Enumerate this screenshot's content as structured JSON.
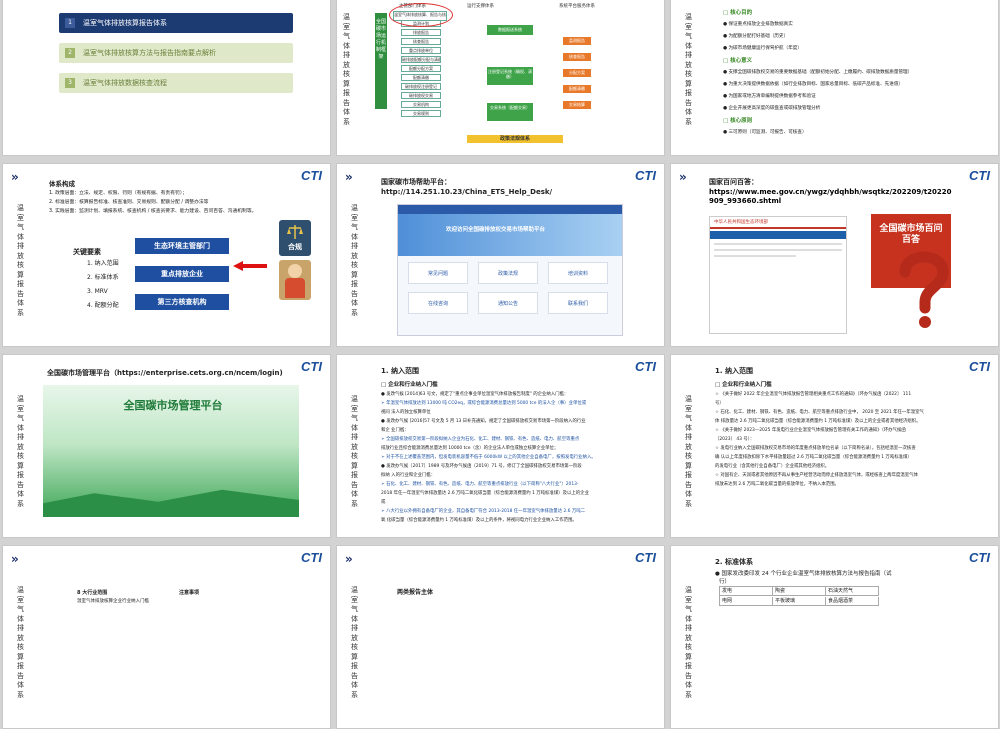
{
  "vertical_caption": "温室气体排放核算报告体系",
  "logo_text": "CTI",
  "chevron": "»",
  "slide1": {
    "items": [
      {
        "num": "1",
        "label": "温室气体排放核算报告体系"
      },
      {
        "num": "2",
        "label": "温室气体排放核算方法与报告指南要点解析"
      },
      {
        "num": "3",
        "label": "温室气体排放数据核查流程"
      }
    ]
  },
  "slide2": {
    "vertical_label": "全国碳市场运行机制框架",
    "col_heads": [
      "主管部门体系",
      "运行支撑体系",
      "系统平台服务体系"
    ],
    "left_boxes": [
      "温室气体排放核算、报告与核查",
      "监测计划",
      "排放报告",
      "核查报告",
      "重点排放单位",
      "碳排放配额分配与清缴",
      "配额分配方案",
      "配额清缴",
      "碳排放权注册登记",
      "碳排放权交易",
      "交易机构",
      "交易规则"
    ],
    "green_boxes": [
      "数据报送系统",
      "注册登记系统（确权、清缴）",
      "交易系统（配额交易）"
    ],
    "right_labels": [
      "监测报告",
      "核查报告",
      "分配方案",
      "配额清缴",
      "交易结算"
    ],
    "bottom_label": "政策法规体系"
  },
  "slide3": {
    "lines": [
      {
        "marker": "□",
        "text": "核心目的",
        "style": "green"
      },
      {
        "marker": "●",
        "text": "保证重点排放企业排放数据真实",
        "style": ""
      },
      {
        "marker": "●",
        "text": "为配额分配打好基础（历史）",
        "style": ""
      },
      {
        "marker": "●",
        "text": "为碳市场健康运行保驾护航（年度）",
        "style": ""
      },
      {
        "marker": "□",
        "text": "核心意义",
        "style": "green"
      },
      {
        "marker": "●",
        "text": "支撑全国碳排放权交易的重要数据基础（配额初始分配、上缴履约、碳排放数据质量管理）",
        "style": ""
      },
      {
        "marker": "●",
        "text": "为重大决策提供数据依据（如行业排放目标、国家总量目标、低碳产品标准、先进值）",
        "style": ""
      },
      {
        "marker": "●",
        "text": "为国家或地方清单编制提供数据参考和验证",
        "style": ""
      },
      {
        "marker": "●",
        "text": "企业开展更高深度的碳盘查或碳排放管理分析",
        "style": ""
      },
      {
        "marker": "□",
        "text": "核心原则",
        "style": "green"
      },
      {
        "marker": "●",
        "text": "三可原则（可监测、可报告、可核查）",
        "style": ""
      }
    ]
  },
  "slide4": {
    "title": "体系构成",
    "lines": [
      "1. 政策层面：立法、规定、权限、罚则（有规有据、有责有罚）；",
      "2. 标准层面：核算报告标准、核查准则、交易规则、配额分配 / 调整办法等",
      "3. 实践层面：监测计划、填报系统、核查机构 / 核查员要求、能力建设、百问百答、沟通机制等。"
    ],
    "key_title": "关键要素",
    "key_items": [
      "1. 纳入范围",
      "2. 标准体系",
      "3. MRV",
      "4. 配额分配"
    ],
    "buttons": [
      "生态环境主管部门",
      "重点排放企业",
      "第三方核查机构"
    ],
    "badge": "合规"
  },
  "slide5": {
    "title": "国家碳市场帮助平台：",
    "url": "http://114.251.10.23/China_ETS_Help_Desk/",
    "banner": "欢迎访问全国碳排放权交易市场帮助平台",
    "tiles": [
      "常见问题",
      "政策法规",
      "培训资料",
      "在线咨询",
      "通知公告",
      "联系我们"
    ]
  },
  "slide6": {
    "title": "国家百问百答：",
    "url": "https://www.mee.gov.cn/ywgz/ydqhbh/wsqtkz/202209/t20220909_993660.shtml",
    "site_header": "中华人民共和国生态环境部",
    "book_title": "全国碳市场百问百答"
  },
  "slide7": {
    "title": "全国碳市场管理平台（https://enterprise.cets.org.cn/ncem/login)",
    "banner": "全国碳市场管理平台"
  },
  "slide8": {
    "heading": "1. 纳入范围",
    "sub": "□ 企业和行业纳入门槛",
    "lines": [
      "● 发改气候 [2014]63 号文，规定了\"重点企事业单位温室气体排放报告制度\" 的企业纳入门槛：",
      "➢ 年温室气体排放达到 13000 吨 CO2eq，或综合能源消费总量达到 5000 tce 的法人企（事）业单位或",
      "视同  法人的独立核算单位",
      "● 发改办气候 [2016]57 号文及 5 月 13 日补充通知，规定了全国碳排放权交易市场第一阶段纳入的行业",
      "和企  业门槛：",
      "➢ 全国碳排放权交易第一阶段拟纳入企业为石化、化工、建材、钢铁、有色、造纸、电力、航空等重点",
      "排放行业且综合能源消费总量达到 10000 tce（含）的企业法人单位或独立核算企业单位；",
      "➢ 对于不在上述覆盖范围内，但发电装机容量不低于 6000kW 以上的其他企业自备电厂，按照发电行业纳入。",
      "● 发改办气候〔2017〕1989 号及环办气候函〔2019〕71 号，修订了全国碳排放权交易市场第一阶段",
      "  拟纳  入的行业和企业门槛：",
      "➢ 石化、化工、建材、钢铁、有色、造纸、电力、航空等重点排放行业（以下简称\"八大行业\"）2013-",
      "2018 年任一年温室气体排放量达 2.6 万吨二氧化碳当量（综合能源消费量约 1 万吨标准煤）及以上的企业",
      "或",
      "➢ 八大行业以外拥有自备电厂的企业，其自备电厂符合 2013-2018 任一年温室气体排放量达 2.6 万吨二",
      "氧  化碳当量（综合能源消费量约 1 万吨标准煤）及以上的条件，将视同电力行业企业纳入工作范围。"
    ]
  },
  "slide9": {
    "heading": "1. 纳入范围",
    "sub": "□ 企业和行业纳入门槛",
    "lines": [
      "☆ 《关于做好 2022 年企业温室气体排放报告管理相关重点工作的通知》（环办气候函〔2022〕 111",
      "号）",
      "☆ 石化、化工、建材、钢铁、有色、造纸、电力、航空等重点排放行业中， 2020 至 2021 年任一年温室气",
      "体 排放量达 2.6 万吨二氧化碳当量（综合能源消费量约 1 万吨标准煤）及以上的企业或者其他经济组织。",
      "☆ 《关于做好 2023—2025 年发电行业企业温室气体排放报告管理有关工作的通知》（环办气候函",
      "〔2023〕 43 号）：",
      "☆ 发电行业纳入全国碳排放权交易市场的年度重点排放单位名录（以下简称名录），包括经温室一次核查",
      "确  认以上年度排放扣除下水平排放量超过 2.6 万吨二氧化碳当量（综合能源消费量约 1 万吨标准煤）",
      "的发电行业（含其他行业自备电厂）企业或其他经济组织。",
      "☆ 对国有企、天润或者其他原因不再从事生产经营活动而停止排放温室气体，或经核查上两年度温室气体",
      "排放未达到 2.6 万吨二氧化碳当量的排放单位，不纳入本范围。"
    ]
  },
  "slide10": {
    "heading": "8 大行业范围",
    "note_title": "注意事项",
    "line": "温室气体排放核算企业行业纳入门槛"
  },
  "slide11": {
    "heading": "两类报告主体"
  },
  "slide12": {
    "heading": "2. 标准体系",
    "line1": "● 国家发改委印发 24 个行业企业温室气体排放核算方法与报告指南（试",
    "line2": "行）",
    "table": [
      [
        "发电",
        "陶瓷",
        "石油天然气"
      ],
      [
        "电网",
        "平板玻璃",
        "食品烟酒茶"
      ]
    ]
  }
}
